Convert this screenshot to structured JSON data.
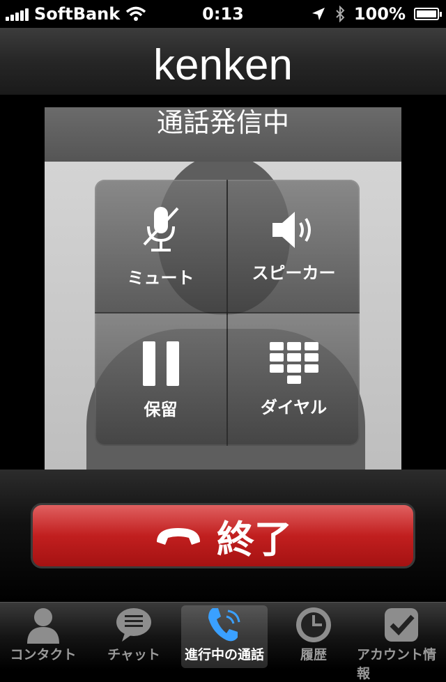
{
  "status_bar": {
    "carrier": "SoftBank",
    "time": "0:13",
    "battery": "100%"
  },
  "call": {
    "caller_name": "kenken",
    "status": "通話発信中"
  },
  "controls": {
    "mute": "ミュート",
    "speaker": "スピーカー",
    "hold": "保留",
    "dial": "ダイヤル"
  },
  "end_call": {
    "label": "終了"
  },
  "tabs": [
    {
      "label": "コンタクト",
      "icon": "contact-icon",
      "active": false
    },
    {
      "label": "チャット",
      "icon": "chat-icon",
      "active": false
    },
    {
      "label": "進行中の通話",
      "icon": "phone-call-icon",
      "active": true
    },
    {
      "label": "履歴",
      "icon": "clock-icon",
      "active": false
    },
    {
      "label": "アカウント情報",
      "icon": "account-icon",
      "active": false
    }
  ],
  "colors": {
    "end_call": "#c11f1f",
    "active_tab_icon": "#3aa0ff"
  }
}
